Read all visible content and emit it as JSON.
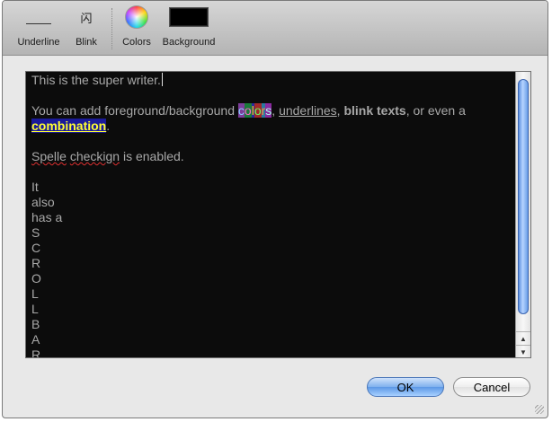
{
  "toolbar": {
    "underline_label": "Underline",
    "blink_label": "Blink",
    "blink_glyph": "闪",
    "colors_label": "Colors",
    "background_label": "Background",
    "background_swatch_color": "#000000"
  },
  "editor": {
    "line1": "This is the super writer.",
    "line2_prefix": "You can add foreground/background ",
    "line2_colors_chars": [
      "c",
      "o",
      "l",
      "o",
      "r",
      "s"
    ],
    "line2_sep1": ", ",
    "line2_underlines": "underlines",
    "line2_sep2": ", ",
    "line2_blink": "blink texts",
    "line2_suffix": ", or even a",
    "line3_combination": "combination",
    "line3_period": ".",
    "line4_spelle": "Spelle",
    "line4_space": " ",
    "line4_checkign": "checkign",
    "line4_rest": " is enabled.",
    "words": [
      "It",
      "also",
      "has a",
      "S",
      "C",
      "R",
      "O",
      "L",
      "L",
      "B",
      "A",
      "R"
    ],
    "background_color": "#0c0c0c",
    "text_color": "#a8a8a8"
  },
  "scrollbar": {
    "up_arrow": "▲",
    "down_arrow": "▼"
  },
  "buttons": {
    "ok": "OK",
    "cancel": "Cancel"
  }
}
